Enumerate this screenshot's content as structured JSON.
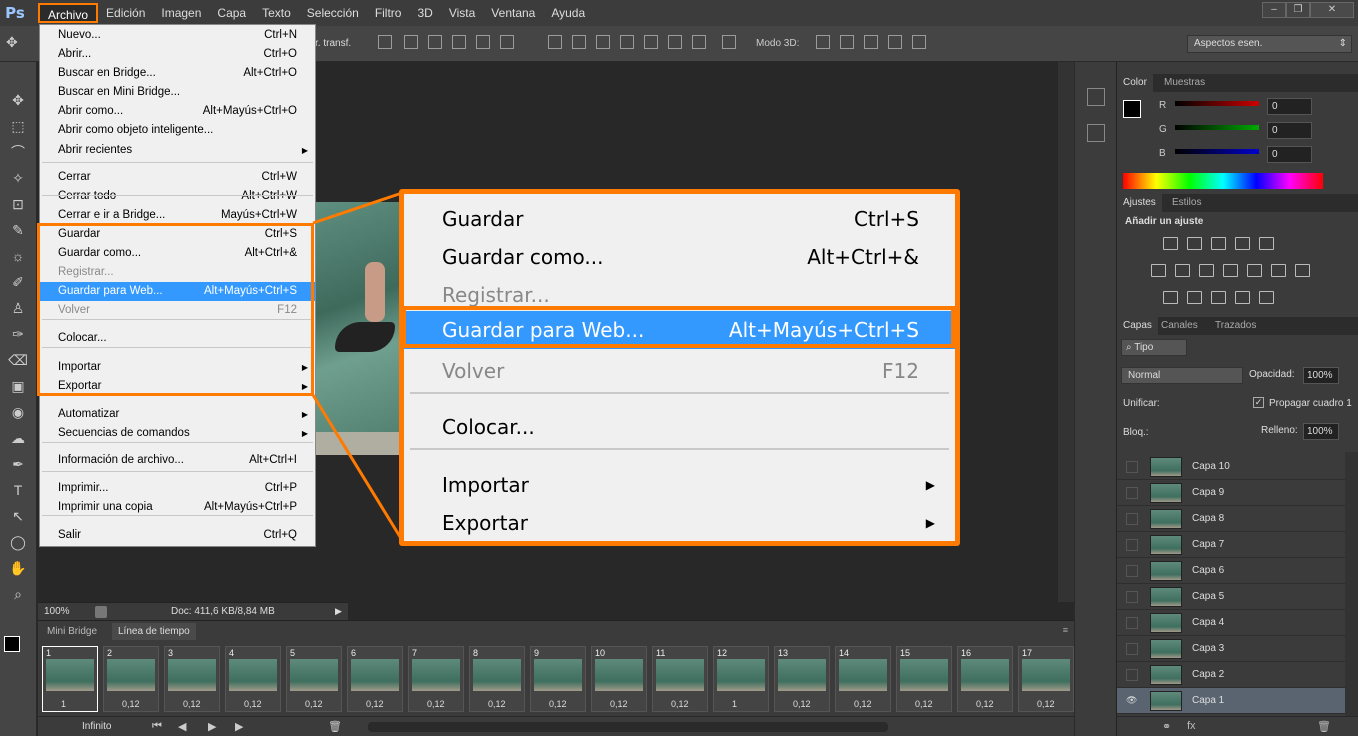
{
  "app": {
    "logo": "Ps",
    "accent": "#ff7a00",
    "highlight": "#3399ff"
  },
  "menubar": [
    "Archivo",
    "Edición",
    "Imagen",
    "Capa",
    "Texto",
    "Selección",
    "Filtro",
    "3D",
    "Vista",
    "Ventana",
    "Ayuda"
  ],
  "options": {
    "transf_label": "r. transf.",
    "mode3d": "Modo 3D:",
    "workspace": "Aspectos esen."
  },
  "status": {
    "zoom": "100%",
    "doc": "Doc: 411,6 KB/8,84 MB"
  },
  "timeline": {
    "tabs": [
      "Mini Bridge",
      "Línea de tiempo"
    ],
    "frames": [
      {
        "n": "1",
        "d": "1"
      },
      {
        "n": "2",
        "d": "0,12"
      },
      {
        "n": "3",
        "d": "0,12"
      },
      {
        "n": "4",
        "d": "0,12"
      },
      {
        "n": "5",
        "d": "0,12"
      },
      {
        "n": "6",
        "d": "0,12"
      },
      {
        "n": "7",
        "d": "0,12"
      },
      {
        "n": "8",
        "d": "0,12"
      },
      {
        "n": "9",
        "d": "0,12"
      },
      {
        "n": "10",
        "d": "0,12"
      },
      {
        "n": "11",
        "d": "0,12"
      },
      {
        "n": "12",
        "d": "1"
      },
      {
        "n": "13",
        "d": "0,12"
      },
      {
        "n": "14",
        "d": "0,12"
      },
      {
        "n": "15",
        "d": "0,12"
      },
      {
        "n": "16",
        "d": "0,12"
      },
      {
        "n": "17",
        "d": "0,12"
      }
    ],
    "loop": "Infinito"
  },
  "color_panel": {
    "tabs": [
      "Color",
      "Muestras"
    ],
    "channels": [
      {
        "l": "R",
        "v": "0"
      },
      {
        "l": "G",
        "v": "0"
      },
      {
        "l": "B",
        "v": "0"
      }
    ]
  },
  "adjust_panel": {
    "tabs": [
      "Ajustes",
      "Estilos"
    ],
    "title": "Añadir un ajuste"
  },
  "layers_panel": {
    "tabs": [
      "Capas",
      "Canales",
      "Trazados"
    ],
    "filter": "Tipo",
    "blend": "Normal",
    "opacity_label": "Opacidad:",
    "opacity": "100%",
    "unify": "Unificar:",
    "propagate": "Propagar cuadro 1",
    "lock": "Bloq.:",
    "fill_label": "Relleno:",
    "fill": "100%",
    "layers": [
      "Capa 10",
      "Capa 9",
      "Capa 8",
      "Capa 7",
      "Capa 6",
      "Capa 5",
      "Capa 4",
      "Capa 3",
      "Capa 2",
      "Capa 1"
    ]
  },
  "dropdown": [
    {
      "l": "Nuevo...",
      "s": "Ctrl+N"
    },
    {
      "l": "Abrir...",
      "s": "Ctrl+O"
    },
    {
      "l": "Buscar en Bridge...",
      "s": "Alt+Ctrl+O"
    },
    {
      "l": "Buscar en Mini Bridge...",
      "s": ""
    },
    {
      "l": "Abrir como...",
      "s": "Alt+Mayús+Ctrl+O"
    },
    {
      "l": "Abrir como objeto inteligente...",
      "s": ""
    },
    {
      "l": "Abrir recientes",
      "s": "",
      "sub": true
    },
    {
      "l": "Cerrar",
      "s": "Ctrl+W"
    },
    {
      "l": "Cerrar todo",
      "s": "Alt+Ctrl+W"
    },
    {
      "l": "Cerrar e ir a Bridge...",
      "s": "Mayús+Ctrl+W"
    },
    {
      "l": "Guardar",
      "s": "Ctrl+S"
    },
    {
      "l": "Guardar como...",
      "s": "Alt+Ctrl+&"
    },
    {
      "l": "Registrar...",
      "s": "",
      "dis": true
    },
    {
      "l": "Guardar para Web...",
      "s": "Alt+Mayús+Ctrl+S",
      "hl": true
    },
    {
      "l": "Volver",
      "s": "F12",
      "dis": true
    },
    {
      "l": "Colocar...",
      "s": ""
    },
    {
      "l": "Importar",
      "s": "",
      "sub": true
    },
    {
      "l": "Exportar",
      "s": "",
      "sub": true
    },
    {
      "l": "Automatizar",
      "s": "",
      "sub": true
    },
    {
      "l": "Secuencias de comandos",
      "s": "",
      "sub": true
    },
    {
      "l": "Información de archivo...",
      "s": "Alt+Ctrl+I"
    },
    {
      "l": "Imprimir...",
      "s": "Ctrl+P"
    },
    {
      "l": "Imprimir una copia",
      "s": "Alt+Mayús+Ctrl+P"
    },
    {
      "l": "Salir",
      "s": "Ctrl+Q"
    }
  ],
  "zoom": [
    {
      "l": "Guardar",
      "s": "Ctrl+S"
    },
    {
      "l": "Guardar como...",
      "s": "Alt+Ctrl+&"
    },
    {
      "l": "Registrar...",
      "s": "",
      "dis": true
    },
    {
      "l": "Guardar para Web...",
      "s": "Alt+Mayús+Ctrl+S",
      "hl": true
    },
    {
      "l": "Volver",
      "s": "F12",
      "dis": true
    },
    {
      "l": "Colocar...",
      "s": ""
    },
    {
      "l": "Importar",
      "s": "",
      "sub": true
    },
    {
      "l": "Exportar",
      "s": "",
      "sub": true
    }
  ]
}
